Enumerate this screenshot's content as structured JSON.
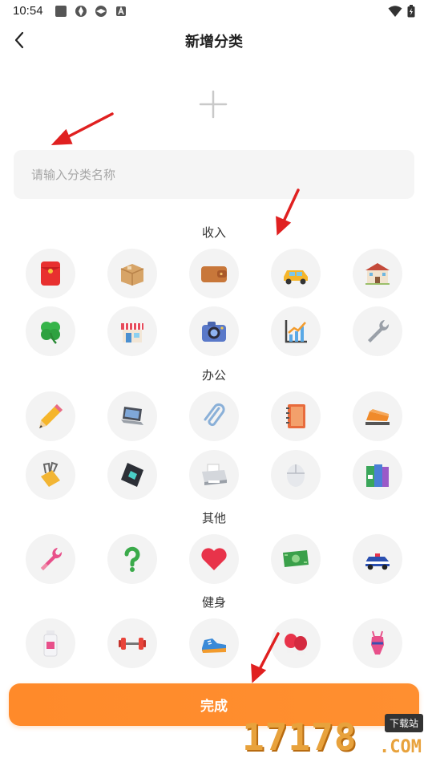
{
  "status_bar": {
    "time": "10:54",
    "left_icons": [
      "square-icon",
      "app-icon",
      "app-icon",
      "a-icon"
    ],
    "right_icons": [
      "wifi-icon",
      "battery-icon"
    ]
  },
  "nav": {
    "title": "新增分类",
    "back_icon": "chevron-left-icon"
  },
  "add_icon_button": {
    "icon": "plus-icon"
  },
  "name_input": {
    "placeholder": "请输入分类名称",
    "value": ""
  },
  "sections": [
    {
      "title": "收入",
      "rows": [
        [
          "red-envelope",
          "package-box",
          "wallet",
          "taxi-car",
          "school-building"
        ],
        [
          "four-leaf-clover",
          "shop-store",
          "camera",
          "growth-chart",
          "wrench"
        ]
      ]
    },
    {
      "title": "办公",
      "rows": [
        [
          "pencil",
          "laptop",
          "paper-clip",
          "notebook",
          "stapler"
        ],
        [
          "binder-clip",
          "hard-drive",
          "printer",
          "computer-mouse",
          "binders"
        ]
      ]
    },
    {
      "title": "其他",
      "rows": [
        [
          "repair-wrench",
          "question-mark",
          "heart",
          "cash-money",
          "police-car"
        ]
      ]
    },
    {
      "title": "健身",
      "rows": [
        [
          "protein-bottle",
          "dumbbell",
          "running-shoe",
          "boxing-gloves",
          "swimsuit"
        ]
      ]
    }
  ],
  "finish_button": {
    "label": "完成"
  },
  "watermark": {
    "digits": "17178",
    "badge": "下载站",
    "suffix": ".COM"
  },
  "colors": {
    "accent": "#ff8a2a",
    "icon_bg": "#f3f3f3",
    "input_bg": "#f5f5f5",
    "annotation_arrow": "#e02020"
  }
}
